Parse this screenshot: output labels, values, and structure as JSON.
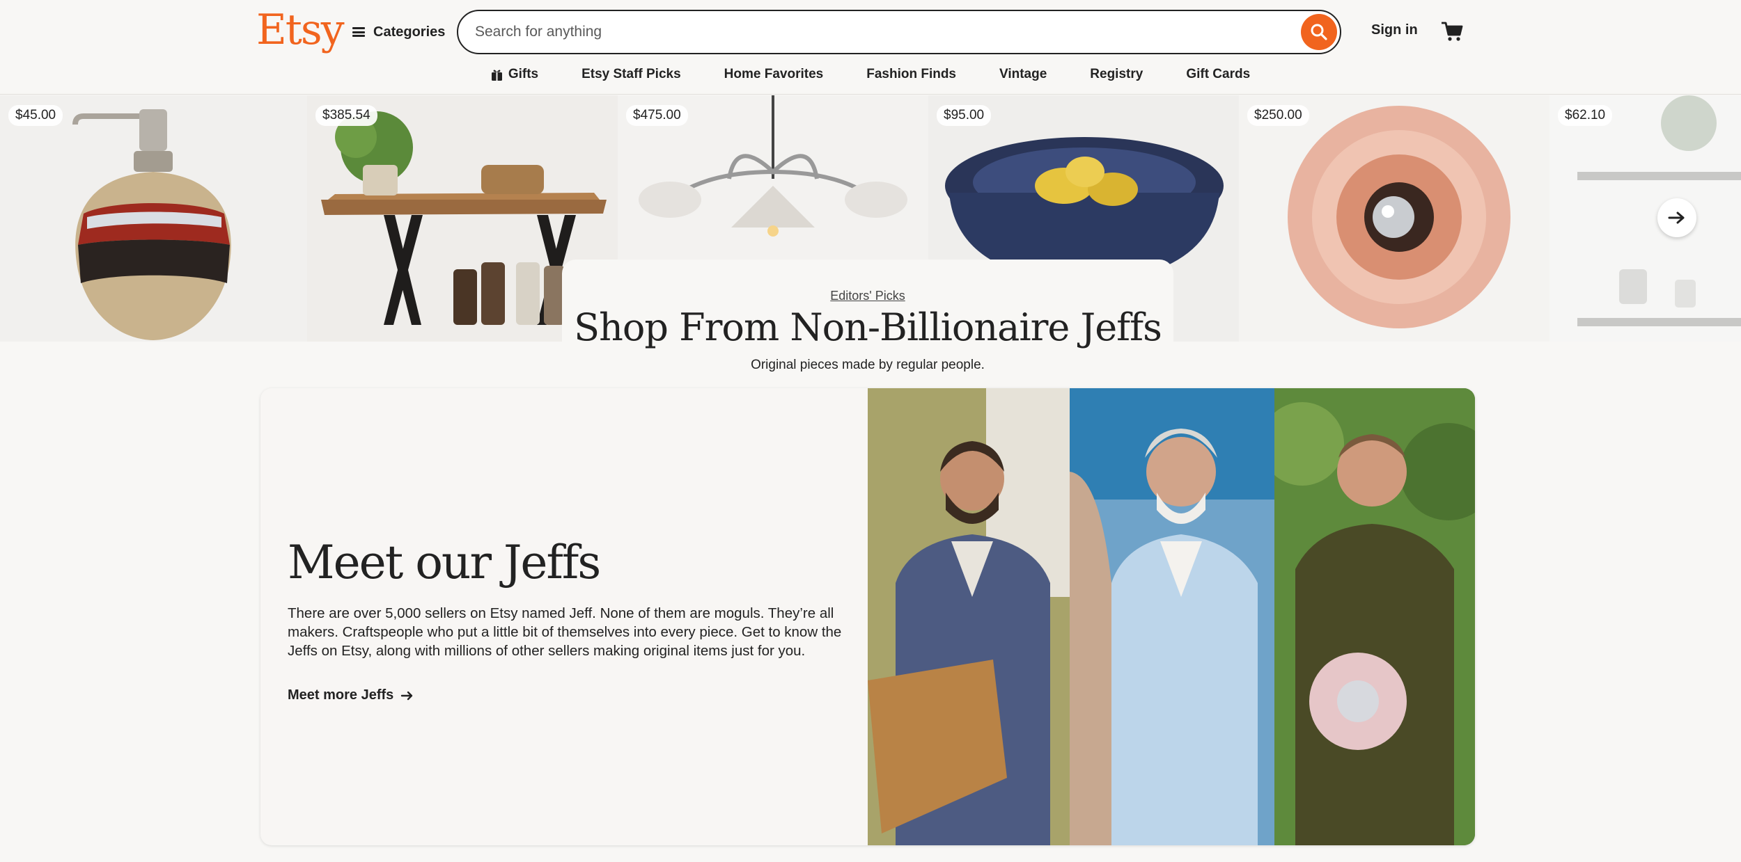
{
  "brand": {
    "logo": "Etsy",
    "accent": "#f1641e"
  },
  "header": {
    "categories_label": "Categories",
    "search_placeholder": "Search for anything",
    "search_value": "",
    "signin_label": "Sign in"
  },
  "nav": {
    "items": [
      {
        "label": "Gifts",
        "icon": "gift-icon"
      },
      {
        "label": "Etsy Staff Picks"
      },
      {
        "label": "Home Favorites"
      },
      {
        "label": "Fashion Finds"
      },
      {
        "label": "Vintage"
      },
      {
        "label": "Registry"
      },
      {
        "label": "Gift Cards"
      }
    ]
  },
  "carousel": {
    "items": [
      {
        "price": "$45.00",
        "subject": "soap-dispenser"
      },
      {
        "price": "$385.54",
        "subject": "wooden-bench"
      },
      {
        "price": "$475.00",
        "subject": "chandelier"
      },
      {
        "price": "$95.00",
        "subject": "ceramic-bowl"
      },
      {
        "price": "$250.00",
        "subject": "glass-lamp"
      },
      {
        "price": "$62.10",
        "subject": "shelves"
      }
    ]
  },
  "editor": {
    "kicker": "Editors' Picks",
    "title": "Shop From Non-Billionaire Jeffs",
    "subtitle": "Original pieces made by regular people."
  },
  "meet": {
    "title": "Meet our Jeffs",
    "description": "There are over 5,000 sellers on Etsy named Jeff. None of them are moguls. They’re all makers. Craftspeople who put a little bit of themselves into every piece. Get to know the Jeffs on Etsy, along with millions of other sellers making original items just for you.",
    "link_label": "Meet more Jeffs"
  }
}
